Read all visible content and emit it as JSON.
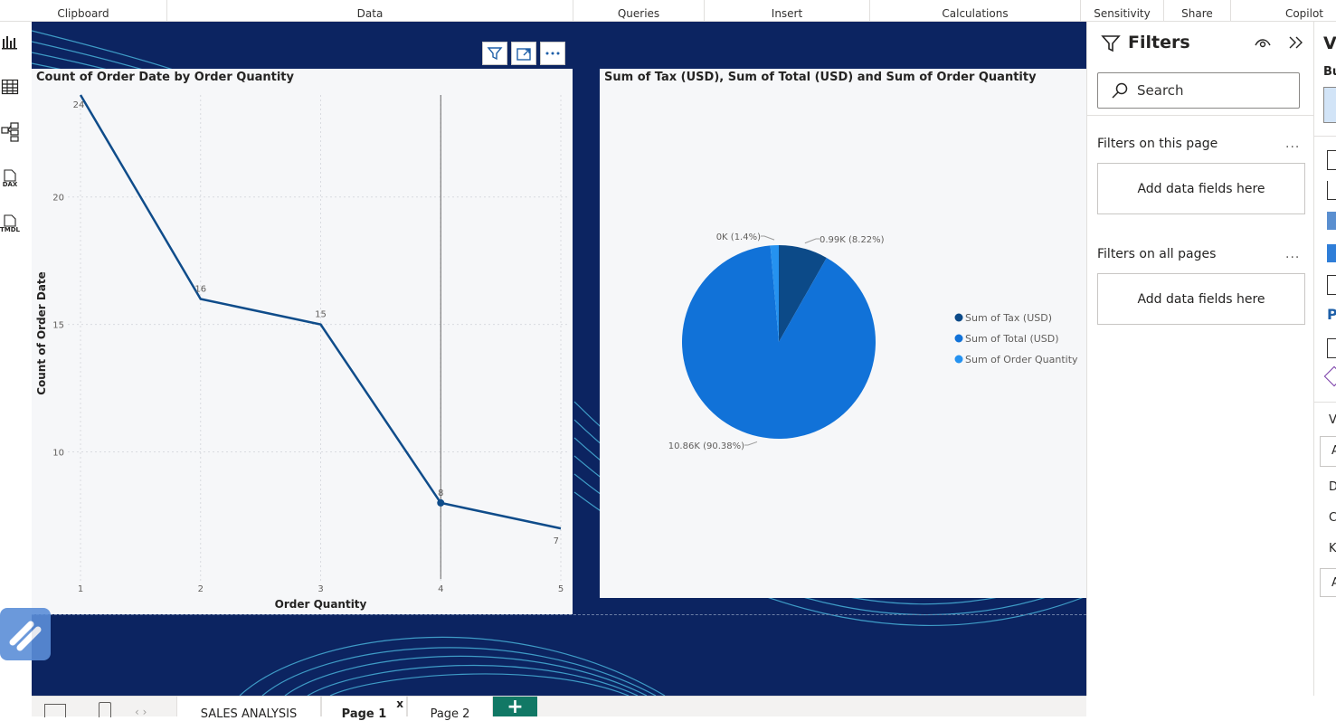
{
  "ribbon": {
    "groups": [
      "Clipboard",
      "Data",
      "Queries",
      "Insert",
      "Calculations",
      "Sensitivity",
      "Share",
      "Copilot"
    ]
  },
  "left_rail": {
    "icons": [
      "report-view-icon",
      "table-view-icon",
      "model-view-icon",
      "dax-query-icon",
      "tmdl-view-icon"
    ],
    "labels": {
      "dax": "DAX",
      "tmdl": "TMDL"
    }
  },
  "line_visual": {
    "title": "Count of Order Date by Order Quantity",
    "xlabel": "Order Quantity",
    "ylabel": "Count of Order Date",
    "toolbar_icons": [
      "filter-icon",
      "focus-mode-icon",
      "more-options-icon"
    ]
  },
  "pie_visual": {
    "title": "Sum of Tax (USD), Sum of Total (USD) and Sum of Order Quantity"
  },
  "chart_data": [
    {
      "type": "line",
      "title": "Count of Order Date by Order Quantity",
      "xlabel": "Order Quantity",
      "ylabel": "Count of Order Date",
      "x": [
        1,
        2,
        3,
        4,
        5
      ],
      "values": [
        24,
        16,
        15,
        8,
        7
      ],
      "data_labels": [
        "24",
        "16",
        "15",
        "8",
        "7"
      ],
      "x_ticks": [
        "1",
        "2",
        "3",
        "4",
        "5"
      ],
      "y_ticks": [
        "10",
        "15",
        "20"
      ],
      "ylim": [
        5.3,
        24
      ],
      "grid": true,
      "highlight_x": 4,
      "color": "#0f4c8a"
    },
    {
      "type": "pie",
      "title": "Sum of Tax (USD), Sum of Total (USD) and Sum of Order Quantity",
      "slices": [
        {
          "name": "Sum of Tax (USD)",
          "value": 0.99,
          "percent": 8.22,
          "label": "0.99K (8.22%)",
          "color": "#0c4a88"
        },
        {
          "name": "Sum of Total (USD)",
          "value": 10.86,
          "percent": 90.38,
          "label": "10.86K (90.38%)",
          "color": "#1172d8"
        },
        {
          "name": "Sum of Order Quantity",
          "value": 0,
          "percent": 1.4,
          "label": "0K (1.4%)",
          "color": "#2592f0"
        }
      ],
      "legend_position": "right"
    }
  ],
  "filters": {
    "title": "Filters",
    "search_placeholder": "Search",
    "on_this_page": "Filters on this page",
    "on_all_pages": "Filters on all pages",
    "drop_hint_1": "Add data fields here",
    "drop_hint_2": "Add data fields here",
    "more_1": "...",
    "more_2": "..."
  },
  "viz_pane": {
    "header_letter": "V",
    "sub_letter": "Bu",
    "letters": [
      "V",
      "A",
      "D",
      "C",
      "K",
      "A"
    ]
  },
  "tabs": {
    "items": [
      "SALES ANALYSIS",
      "Page 1",
      "Page 2"
    ],
    "active_close": "x",
    "add_label": "+"
  },
  "colors": {
    "canvas_bg": "#0c2461",
    "visual_bg": "#f6f7f9",
    "accent_green": "#117865"
  }
}
